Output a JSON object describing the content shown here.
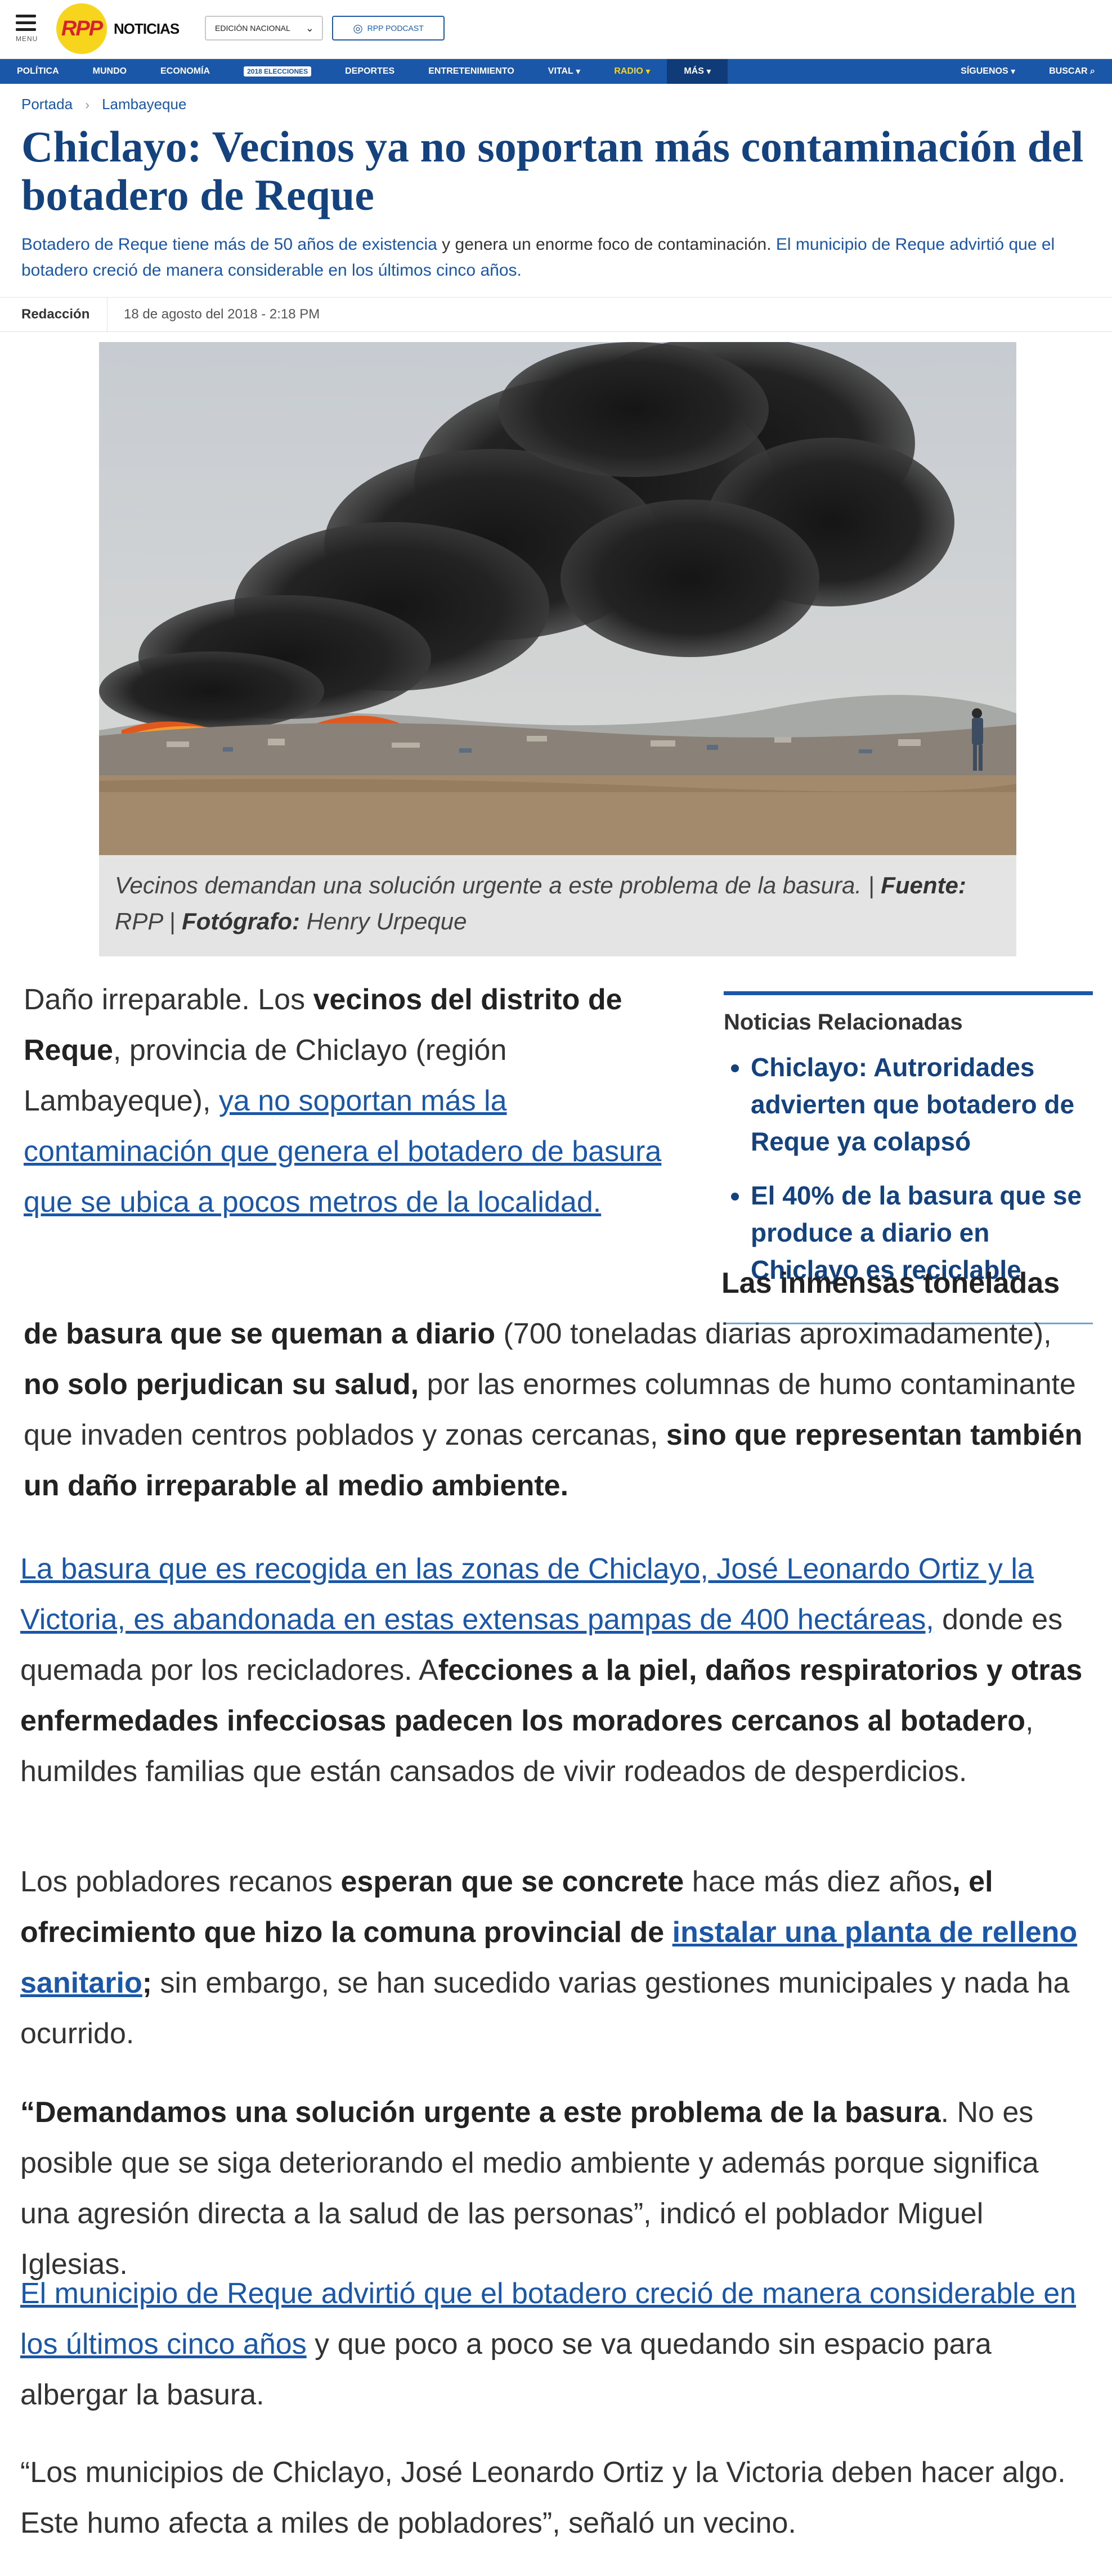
{
  "header": {
    "menu_label": "MENU",
    "logo_mark": "RPP",
    "logo_text": "NOTICIAS",
    "edition_label": "EDICIÓN NACIONAL",
    "podcast_label": "RPP PODCAST"
  },
  "nav": {
    "items": [
      "POLÍTICA",
      "MUNDO",
      "ECONOMÍA",
      "ELECCIONES",
      "DEPORTES",
      "ENTRETENIMIENTO",
      "VITAL",
      "RADIO",
      "MÁS"
    ],
    "elecciones_badge": "2018",
    "right": [
      "SÍGUENOS",
      "BUSCAR"
    ]
  },
  "breadcrumb": {
    "home": "Portada",
    "section": "Lambayeque"
  },
  "article": {
    "title": "Chiclayo: Vecinos ya no soportan más contaminación del botadero de Reque",
    "lead_link1": "Botadero de Reque tiene más de 50 años de existencia",
    "lead_text": " y genera un enorme foco de contaminación. ",
    "lead_link2": "El municipio de Reque advirtió que el botadero creció de manera considerable en los últimos cinco años.",
    "author": "Redacción",
    "date": "18 de agosto del 2018 - 2:18 PM"
  },
  "figure": {
    "caption_text": "Vecinos demandan una solución urgente a este problema de la basura. | ",
    "source_label": "Fuente:",
    "source_value": " RPP | ",
    "photographer_label": "Fotógrafo:",
    "photographer_value": " Henry Urpeque"
  },
  "related": {
    "heading": "Noticias Relacionadas",
    "items": [
      "Chiclayo: Autroridades advierten que botadero de Reque ya colapsó",
      "El 40% de la basura que se produce a diario en Chiclayo es reciclable"
    ]
  },
  "body": {
    "p1": {
      "t1": "Daño irreparable. Los ",
      "b1": "vecinos del distrito de Reque",
      "t2": ", provincia de Chiclayo (región Lambayeque), ",
      "link": "ya no soportan más la contaminación que genera el botadero de basura que se ubica a pocos metros de la localidad."
    },
    "p2": {
      "b1": "Las inmensas toneladas de basura que se queman a diario",
      "t1": " (700 toneladas diarias aproximadamente), ",
      "b2": "no solo perjudican su salud,",
      "t2": " por las enormes columnas de humo contaminante que invaden centros poblados y zonas cercanas, ",
      "b3": "sino que representan también un daño irreparable al medio ambiente."
    },
    "p3": {
      "link": "La basura que es recogida en las zonas de Chiclayo, José Leonardo Ortiz y la Victoria, es abandonada en estas extensas pampas de 400 hectáreas,",
      "t1": " donde es quemada por los recicladores. A",
      "b1": "fecciones a la piel, daños respiratorios y otras enfermedades infecciosas padecen los moradores cercanos al botadero",
      "t2": ", humildes familias que están cansados de vivir rodeados de desperdicios."
    },
    "p4": {
      "t1": "Los pobladores recanos ",
      "b1": "esperan que se concrete",
      "t2": " hace más diez años",
      "b2": ", el ofrecimiento que hizo la comuna provincial de ",
      "link": "instalar una planta de relleno sanitario",
      "b3": ";",
      "t3": " sin embargo, se han sucedido varias gestiones municipales y nada ha ocurrido."
    },
    "p5": {
      "b1": "“Demandamos una solución urgente a este problema de la basura",
      "t1": ". No es posible que se siga deteriorando el medio ambiente y además porque significa una agresión directa a la salud de las personas”, indicó el poblador Miguel Iglesias."
    },
    "p6": {
      "link": "El municipio de Reque advirtió que el botadero creció de manera considerable en los últimos cinco años",
      "t1": " y que poco a poco se va quedando sin espacio para albergar la basura."
    },
    "p7": {
      "t1": "“Los municipios de Chiclayo, José Leonardo Ortiz y la Victoria deben hacer algo. Este humo afecta a miles de pobladores”, señaló un vecino."
    }
  },
  "colors": {
    "brand_blue": "#1a57a8",
    "title_blue": "#14427e",
    "logo_yellow": "#f7d51d",
    "logo_red": "#d8232a"
  }
}
